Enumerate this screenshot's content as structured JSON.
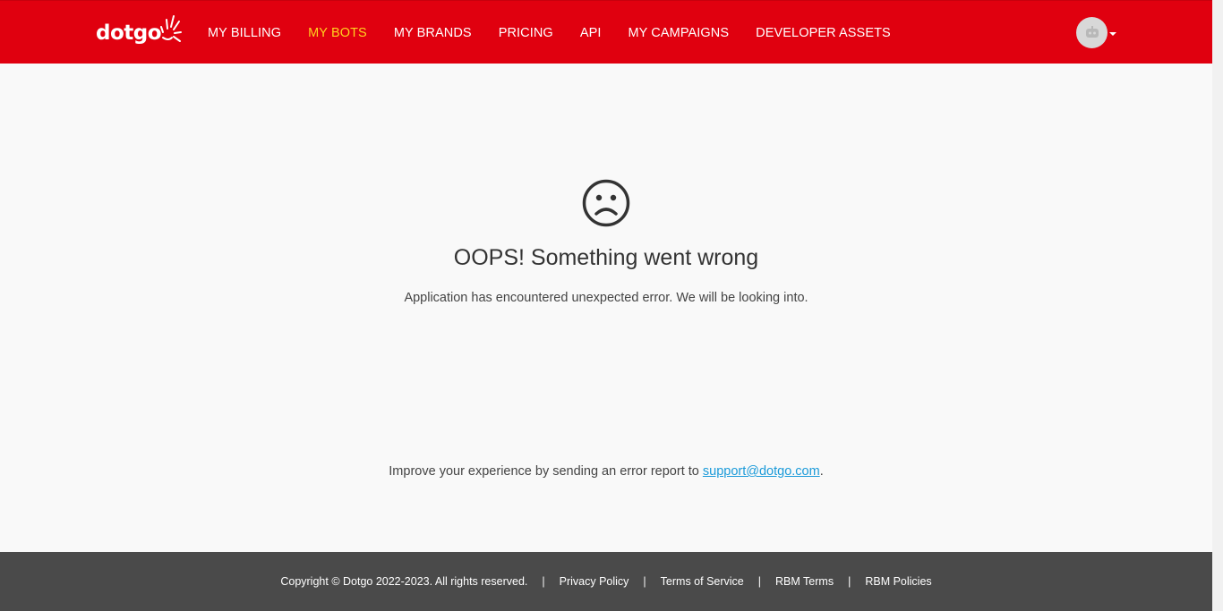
{
  "brand": {
    "logo_text": "dotgo",
    "primary_color": "#e0000f",
    "active_color": "#ffd21f"
  },
  "nav": {
    "items": [
      {
        "label": "MY BILLING",
        "active": false
      },
      {
        "label": "MY BOTS",
        "active": true
      },
      {
        "label": "MY BRANDS",
        "active": false
      },
      {
        "label": "PRICING",
        "active": false
      },
      {
        "label": "API",
        "active": false
      },
      {
        "label": "MY CAMPAIGNS",
        "active": false
      },
      {
        "label": "DEVELOPER ASSETS",
        "active": false
      }
    ]
  },
  "user_menu": {
    "avatar_icon": "robot-icon",
    "caret_icon": "caret-down-icon"
  },
  "error": {
    "icon": "sad-face-icon",
    "title": "OOPS! Something went wrong",
    "description": "Application has encountered unexpected error. We will be looking into.",
    "report_prefix": "Improve your experience by sending an error report to ",
    "report_email": "support@dotgo.com",
    "report_suffix": "."
  },
  "footer": {
    "copyright": "Copyright © Dotgo 2022-2023. All rights reserved.",
    "links": [
      "Privacy Policy",
      "Terms of Service",
      "RBM Terms",
      "RBM Policies"
    ],
    "separator": "|",
    "background": "#4a4a4a"
  }
}
